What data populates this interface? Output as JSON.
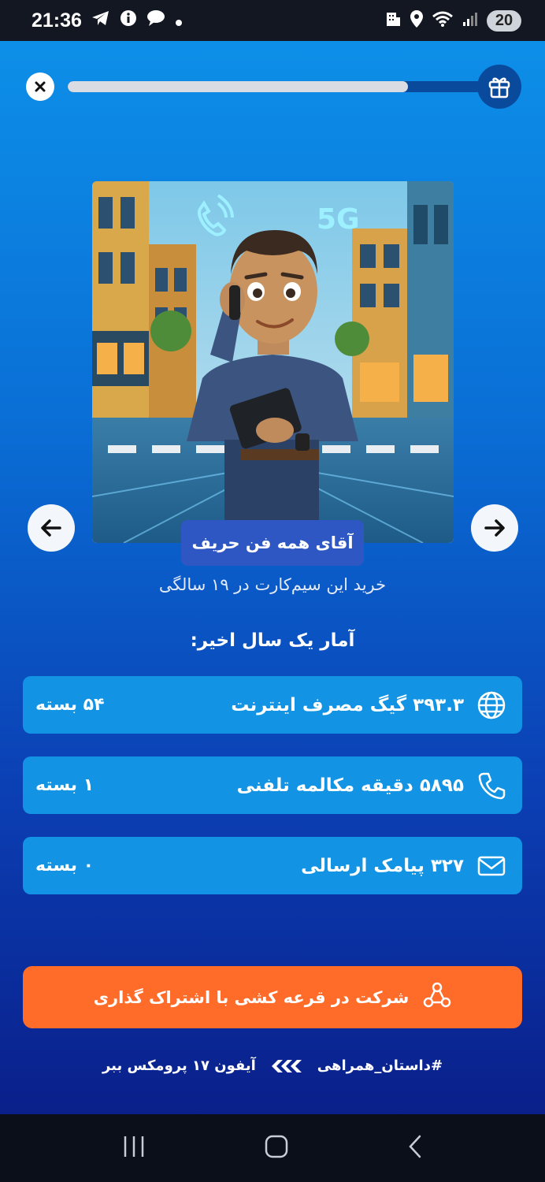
{
  "status_bar": {
    "time": "21:36",
    "battery": "20"
  },
  "progress": {
    "fraction": 0.8
  },
  "hero": {
    "title": "آقای همه فن حریف",
    "image_labels": {
      "network": "5G"
    }
  },
  "subtitle": "خرید این سیم‌کارت در ۱۹ سالگی",
  "stats": {
    "heading": "آمار یک سال اخیر:",
    "items": [
      {
        "icon": "globe-icon",
        "text": "۳۹۳.۳ گیگ مصرف اینترنت",
        "count": "۵۴ بسته"
      },
      {
        "icon": "phone-icon",
        "text": "۵۸۹۵ دقیقه مکالمه تلفنی",
        "count": "۱ بسته"
      },
      {
        "icon": "mail-icon",
        "text": "۳۲۷ پیامک ارسالی",
        "count": "۰ بسته"
      }
    ]
  },
  "cta": {
    "label": "شرکت در قرعه کشی با اشتراک گذاری",
    "icon": "share-icon"
  },
  "footer": {
    "hashtag": "#داستان_همراهی",
    "promo": "آیفون ۱۷ پرومکس ببر"
  },
  "colors": {
    "accent": "#ff6c2a",
    "card": "#1293e3",
    "pill": "#2f57c4"
  }
}
